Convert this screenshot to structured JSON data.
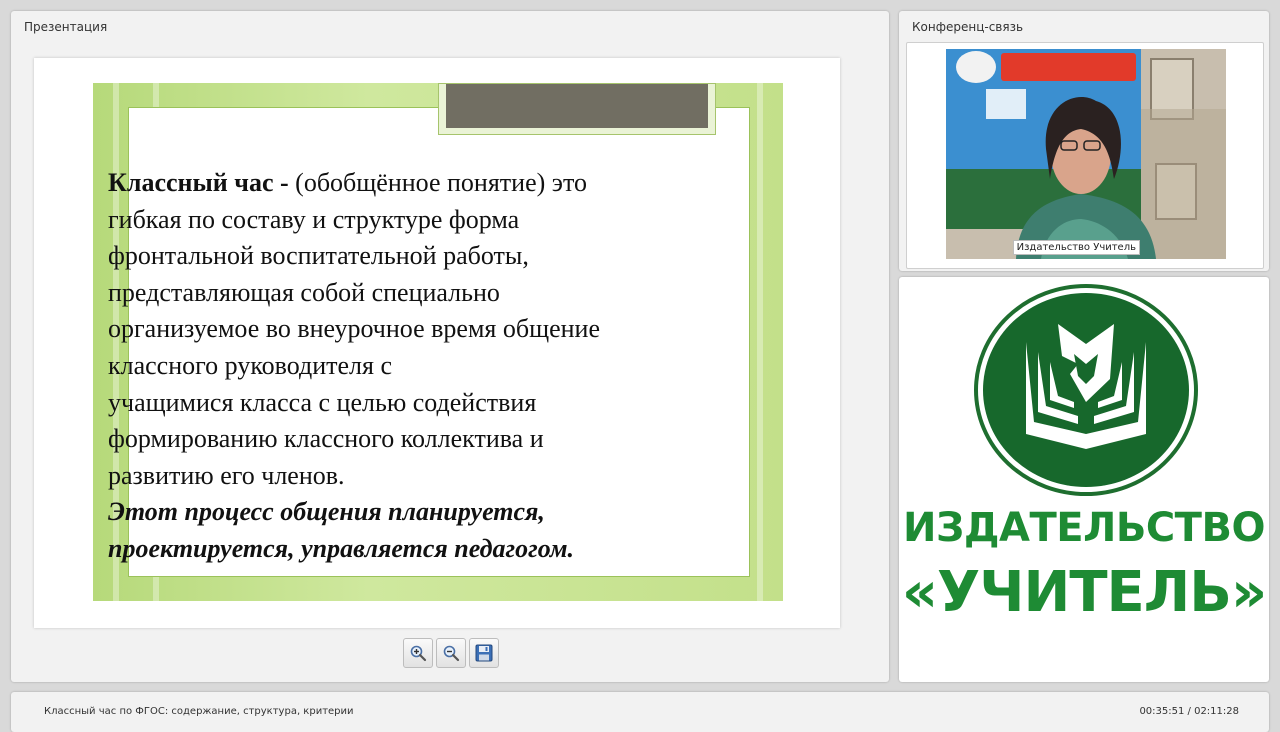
{
  "presentation": {
    "title": "Презентация",
    "slide": {
      "lines": [
        {
          "parts": [
            {
              "text": "Классный час - ",
              "style": "bold"
            },
            {
              "text": "(обобщённое понятие) это",
              "style": "normal"
            }
          ]
        },
        {
          "parts": [
            {
              "text": "гибкая по составу и структуре форма",
              "style": "normal"
            }
          ]
        },
        {
          "parts": [
            {
              "text": "фронтальной воспитательной работы,",
              "style": "normal"
            }
          ]
        },
        {
          "parts": [
            {
              "text": "представляющая собой специально",
              "style": "normal"
            }
          ]
        },
        {
          "parts": [
            {
              "text": "организуемое во внеурочное время общение",
              "style": "normal"
            }
          ]
        },
        {
          "parts": [
            {
              "text": "классного руководителя с",
              "style": "normal"
            }
          ]
        },
        {
          "parts": [
            {
              "text": "учащимися класса с целью содействия",
              "style": "normal"
            }
          ]
        },
        {
          "parts": [
            {
              "text": "формированию классного коллектива и",
              "style": "normal"
            }
          ]
        },
        {
          "parts": [
            {
              "text": "развитию его членов.",
              "style": "normal"
            }
          ]
        },
        {
          "parts": [
            {
              "text": " Этот процесс общения планируется,",
              "style": "bold-italic"
            }
          ]
        },
        {
          "parts": [
            {
              "text": "проектируется, управляется педагогом.",
              "style": "bold-italic"
            }
          ]
        }
      ]
    },
    "toolbar": {
      "zoom_in_icon": "zoom-in-icon",
      "zoom_out_icon": "zoom-out-icon",
      "save_icon": "floppy-disk-icon"
    }
  },
  "conference": {
    "title": "Конференц-связь",
    "video_caption": "Издательство Учитель"
  },
  "logo": {
    "line1": "ИЗДАТЕЛЬСТВО",
    "line2": "«УЧИТЕЛЬ»",
    "brand_color": "#1e8b34"
  },
  "footer": {
    "title": "Классный час по ФГОС: содержание, структура, критерии",
    "time": "00:35:51 / 02:11:28"
  }
}
